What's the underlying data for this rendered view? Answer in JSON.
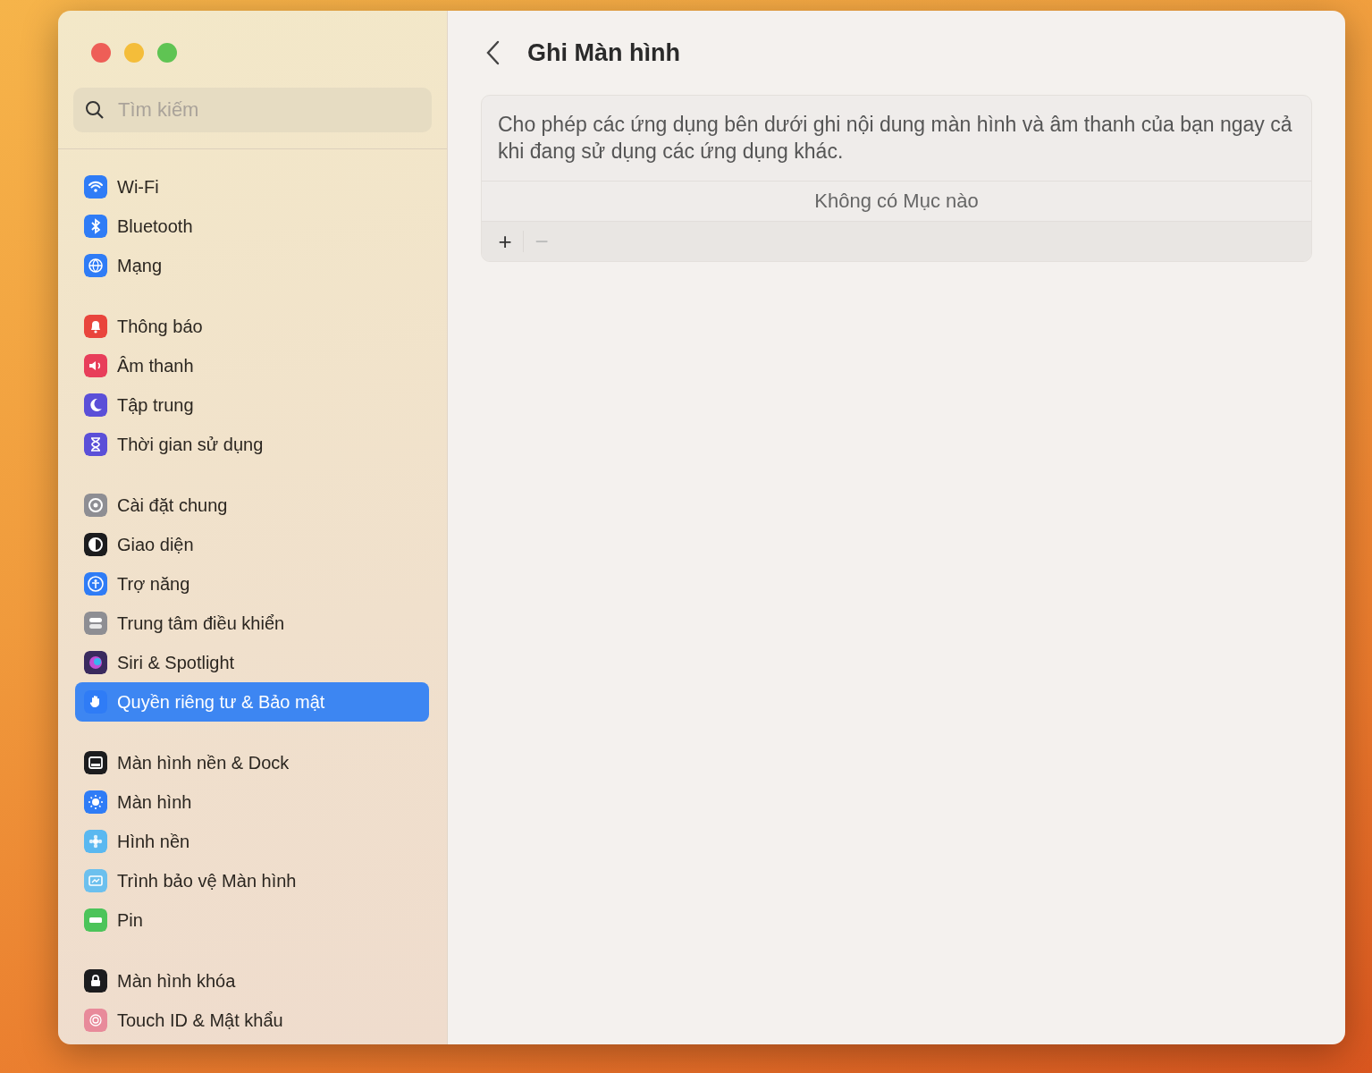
{
  "sidebar": {
    "search": {
      "placeholder": "Tìm kiếm"
    },
    "groups": [
      [
        {
          "label": "Wi-Fi",
          "kind": "wifi",
          "color": "#2f7cf6",
          "selected": false
        },
        {
          "label": "Bluetooth",
          "kind": "bluetooth",
          "color": "#2f7cf6",
          "selected": false
        },
        {
          "label": "Mạng",
          "kind": "globe",
          "color": "#2f7cf6",
          "selected": false
        }
      ],
      [
        {
          "label": "Thông báo",
          "kind": "bell",
          "color": "#e9453c",
          "selected": false
        },
        {
          "label": "Âm thanh",
          "kind": "speaker",
          "color": "#e83e5a",
          "selected": false
        },
        {
          "label": "Tập trung",
          "kind": "moon",
          "color": "#5b4fd8",
          "selected": false
        },
        {
          "label": "Thời gian sử dụng",
          "kind": "hourglass",
          "color": "#5b4fd8",
          "selected": false
        }
      ],
      [
        {
          "label": "Cài đặt chung",
          "kind": "gear",
          "color": "#8e8e93",
          "selected": false
        },
        {
          "label": "Giao diện",
          "kind": "contrast",
          "color": "#1c1c1e",
          "selected": false
        },
        {
          "label": "Trợ năng",
          "kind": "person",
          "color": "#2f7cf6",
          "selected": false
        },
        {
          "label": "Trung tâm điều khiển",
          "kind": "toggles",
          "color": "#8e8e93",
          "selected": false
        },
        {
          "label": "Siri & Spotlight",
          "kind": "orb",
          "color": "#3a2a5e",
          "selected": false
        },
        {
          "label": "Quyền riêng tư & Bảo mật",
          "kind": "hand",
          "color": "#2f7cf6",
          "selected": true
        }
      ],
      [
        {
          "label": "Màn hình nền & Dock",
          "kind": "dock",
          "color": "#1c1c1e",
          "selected": false
        },
        {
          "label": "Màn hình",
          "kind": "sun",
          "color": "#2f7cf6",
          "selected": false
        },
        {
          "label": "Hình nền",
          "kind": "flower",
          "color": "#5ab8f0",
          "selected": false
        },
        {
          "label": "Trình bảo vệ Màn hình",
          "kind": "monitor",
          "color": "#6cc0ee",
          "selected": false
        },
        {
          "label": "Pin",
          "kind": "battery",
          "color": "#4cc45a",
          "selected": false
        }
      ],
      [
        {
          "label": "Màn hình khóa",
          "kind": "lock",
          "color": "#1c1c1e",
          "selected": false
        },
        {
          "label": "Touch ID & Mật khẩu",
          "kind": "fingerprint",
          "color": "#e88a9a",
          "selected": false
        }
      ]
    ]
  },
  "main": {
    "title": "Ghi Màn hình",
    "description": "Cho phép các ứng dụng bên dưới ghi nội dung màn hình và âm thanh của bạn ngay cả khi đang sử dụng các ứng dụng khác.",
    "empty_text": "Không có Mục nào",
    "buttons": [
      {
        "symbol": "+",
        "disabled": false
      },
      {
        "symbol": "−",
        "disabled": true
      }
    ]
  }
}
